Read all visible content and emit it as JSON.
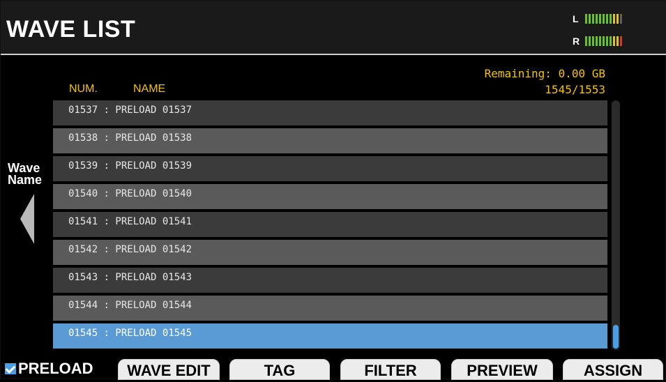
{
  "header": {
    "title": "WAVE LIST",
    "meter_L_label": "L",
    "meter_R_label": "R"
  },
  "info": {
    "remaining": "Remaining: 0.00 GB",
    "count": "1545/1553"
  },
  "columns": {
    "num": "NUM.",
    "name": "NAME"
  },
  "side": {
    "label_line1": "Wave",
    "label_line2": "Name",
    "arrow_icon": "left-triangle-icon"
  },
  "rows": [
    {
      "text": "01537 : PRELOAD 01537",
      "selected": false
    },
    {
      "text": "01538 : PRELOAD 01538",
      "selected": false
    },
    {
      "text": "01539 : PRELOAD 01539",
      "selected": false
    },
    {
      "text": "01540 : PRELOAD 01540",
      "selected": false
    },
    {
      "text": "01541 : PRELOAD 01541",
      "selected": false
    },
    {
      "text": "01542 : PRELOAD 01542",
      "selected": false
    },
    {
      "text": "01543 : PRELOAD 01543",
      "selected": false
    },
    {
      "text": "01544 : PRELOAD 01544",
      "selected": false
    },
    {
      "text": "01545 : PRELOAD 01545",
      "selected": true
    }
  ],
  "footer": {
    "preload_label": "PRELOAD",
    "preload_checked": true,
    "buttons": [
      "WAVE EDIT",
      "TAG",
      "FILTER",
      "PREVIEW",
      "ASSIGN"
    ]
  },
  "colors": {
    "accent_yellow": "#f5c400",
    "selection_blue": "#5b9bd5",
    "scroll_blue": "#4aa0e6"
  }
}
